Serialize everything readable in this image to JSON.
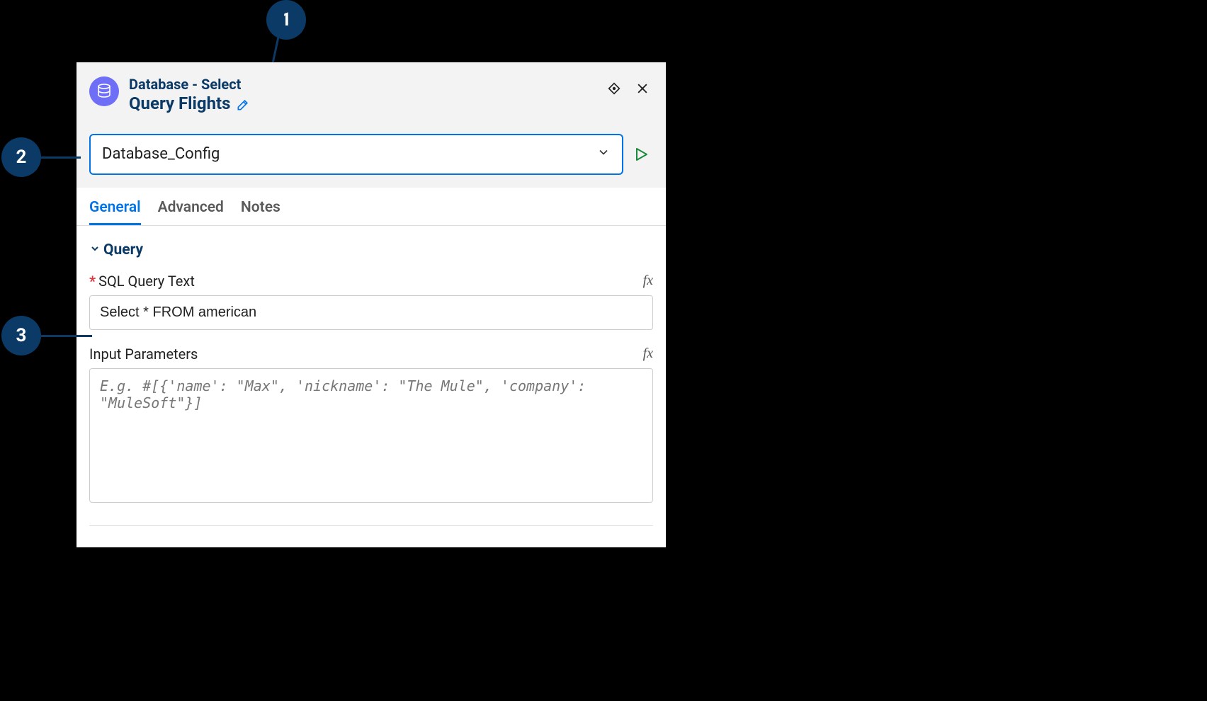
{
  "header": {
    "type_label": "Database - Select",
    "name": "Query Flights"
  },
  "config": {
    "value": "Database_Config"
  },
  "tabs": {
    "general": "General",
    "advanced": "Advanced",
    "notes": "Notes"
  },
  "section": {
    "query_title": "Query"
  },
  "fields": {
    "sql_label": "SQL Query Text",
    "sql_value": "Select * FROM american",
    "params_label": "Input Parameters",
    "params_placeholder": "E.g. #[{'name': \"Max\", 'nickname': \"The Mule\", 'company': \"MuleSoft\"}]"
  },
  "callouts": {
    "c1": "1",
    "c2": "2",
    "c3": "3"
  }
}
